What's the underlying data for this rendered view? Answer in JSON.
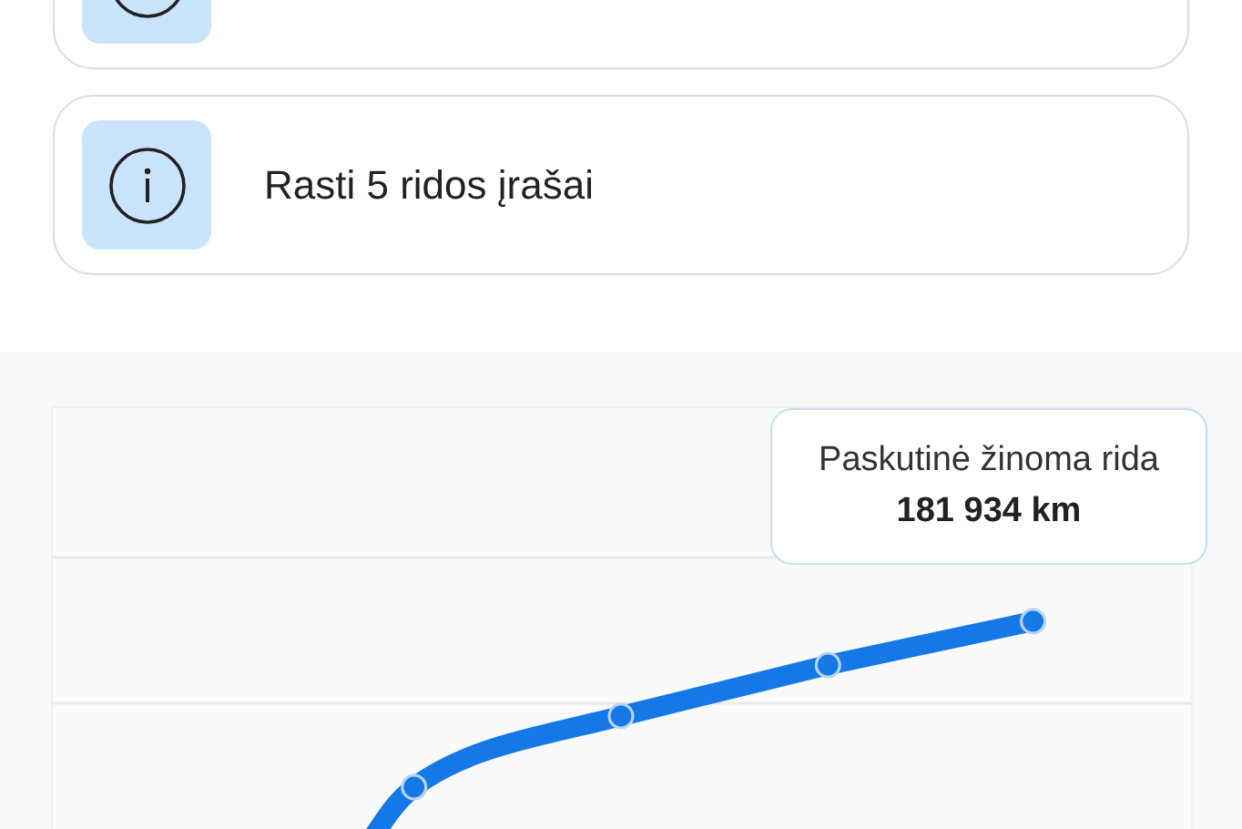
{
  "cards": [
    {
      "kind": "info"
    },
    {
      "kind": "info",
      "text": "Rasti 5 ridos įrašai"
    }
  ],
  "chart": {
    "tooltip": {
      "label": "Paskutinė žinoma rida",
      "value": "181 934 km"
    }
  }
}
